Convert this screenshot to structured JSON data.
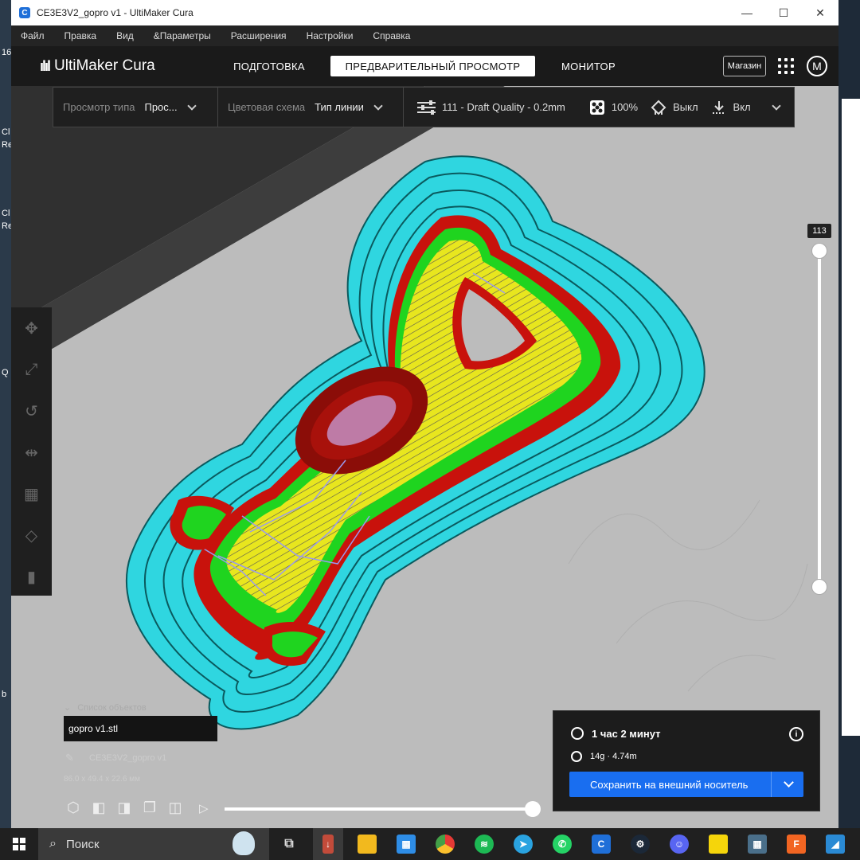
{
  "window": {
    "title": "CE3E3V2_gopro v1 - UltiMaker Cura",
    "controls": {
      "minimize": "—",
      "maximize": "☐",
      "close": "✕"
    }
  },
  "menu": [
    "Файл",
    "Правка",
    "Вид",
    "&Параметры",
    "Расширения",
    "Настройки",
    "Справка"
  ],
  "header": {
    "logo": "UltiMaker Cura",
    "tabs": [
      "ПОДГОТОВКА",
      "ПРЕДВАРИТЕЛЬНЫЙ ПРОСМОТР",
      "МОНИТОР"
    ],
    "active_tab": 1,
    "shop": "Магазин",
    "avatar": "M"
  },
  "settings_bar": {
    "view_type_label": "Просмотр типа",
    "view_type_value": "Прос...",
    "color_scheme_label": "Цветовая схема",
    "color_scheme_value": "Тип линии",
    "profile": "111 - Draft Quality - 0.2mm",
    "infill": "100%",
    "support": "Выкл",
    "adhesion": "Вкл"
  },
  "layer_slider": {
    "value": "113"
  },
  "objects": {
    "list_title": "Список объектов",
    "item": "gopro v1.stl",
    "job_name": "CE3E3V2_gopro v1",
    "dimensions": "86.0 x 49.4 x 22.6 мм"
  },
  "print": {
    "time": "1 час 2 минут",
    "material": "14g · 4.74m",
    "save_button": "Сохранить на внешний носитель"
  },
  "taskbar": {
    "search": "Поиск",
    "apps": [
      "task-view",
      "cura-alt",
      "file-explorer",
      "store",
      "chrome",
      "spotify",
      "telegram",
      "whatsapp",
      "cura",
      "steam",
      "discord",
      "sticky-notes",
      "calculator",
      "fusion",
      "photos"
    ]
  },
  "desktop_left_labels": [
    "16",
    "Cl",
    "Re",
    "Cl",
    "Re",
    "Q",
    "b"
  ],
  "colors": {
    "skirt": "#2fd6e0",
    "wall_outer": "#d4130e",
    "wall_inner": "#1fd41f",
    "infill": "#e8e61e",
    "travel": "#8a8ae8",
    "accent": "#196ef0"
  }
}
